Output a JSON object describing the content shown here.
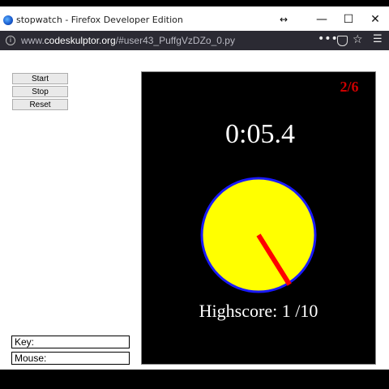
{
  "window": {
    "title": "stopwatch - Firefox Developer Edition",
    "minimize_glyph": "—",
    "maximize_glyph": "☐",
    "close_glyph": "✕",
    "resize_cursor_glyph": "↔"
  },
  "urlbar": {
    "prefix": "www.",
    "domain": "codeskulptor.org",
    "path": "/#user43_PuffgVzDZo_0.py",
    "more_glyph": "•••",
    "star_glyph": "☆",
    "menu_glyph": "☰",
    "info_glyph": "i"
  },
  "controls": {
    "start_label": "Start",
    "stop_label": "Stop",
    "reset_label": "Reset"
  },
  "status": {
    "key_label": "Key:",
    "mouse_label": "Mouse:"
  },
  "canvas": {
    "score": "2/6",
    "time": "0:05.4",
    "highscore": "Highscore: 1 /10",
    "dial_angle_deg": 148,
    "colors": {
      "background": "#000000",
      "dial_fill": "#ffff00",
      "dial_border": "#1a1aff",
      "hand": "#ff0000",
      "score": "#cc0000",
      "text": "#ffffff"
    }
  }
}
